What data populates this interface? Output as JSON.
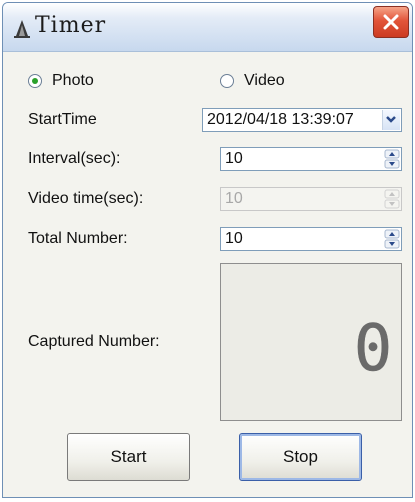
{
  "window": {
    "title": "Timer"
  },
  "mode": {
    "photo_label": "Photo",
    "video_label": "Video",
    "selected": "Photo"
  },
  "start_time": {
    "label": "StartTime",
    "value": "2012/04/18 13:39:07"
  },
  "interval": {
    "label": "Interval(sec):",
    "value": "10"
  },
  "video_time": {
    "label": "Video time(sec):",
    "value": "10"
  },
  "total_number": {
    "label": "Total Number:",
    "value": "10"
  },
  "captured": {
    "label": "Captured Number:",
    "value": "0"
  },
  "buttons": {
    "start_label": "Start",
    "stop_label": "Stop"
  },
  "colors": {
    "title_gradient_end": "#c7d8ee",
    "close_red": "#e2553a",
    "radio_selected": "#2aa02a",
    "display_digit": "#6a6a6a"
  }
}
